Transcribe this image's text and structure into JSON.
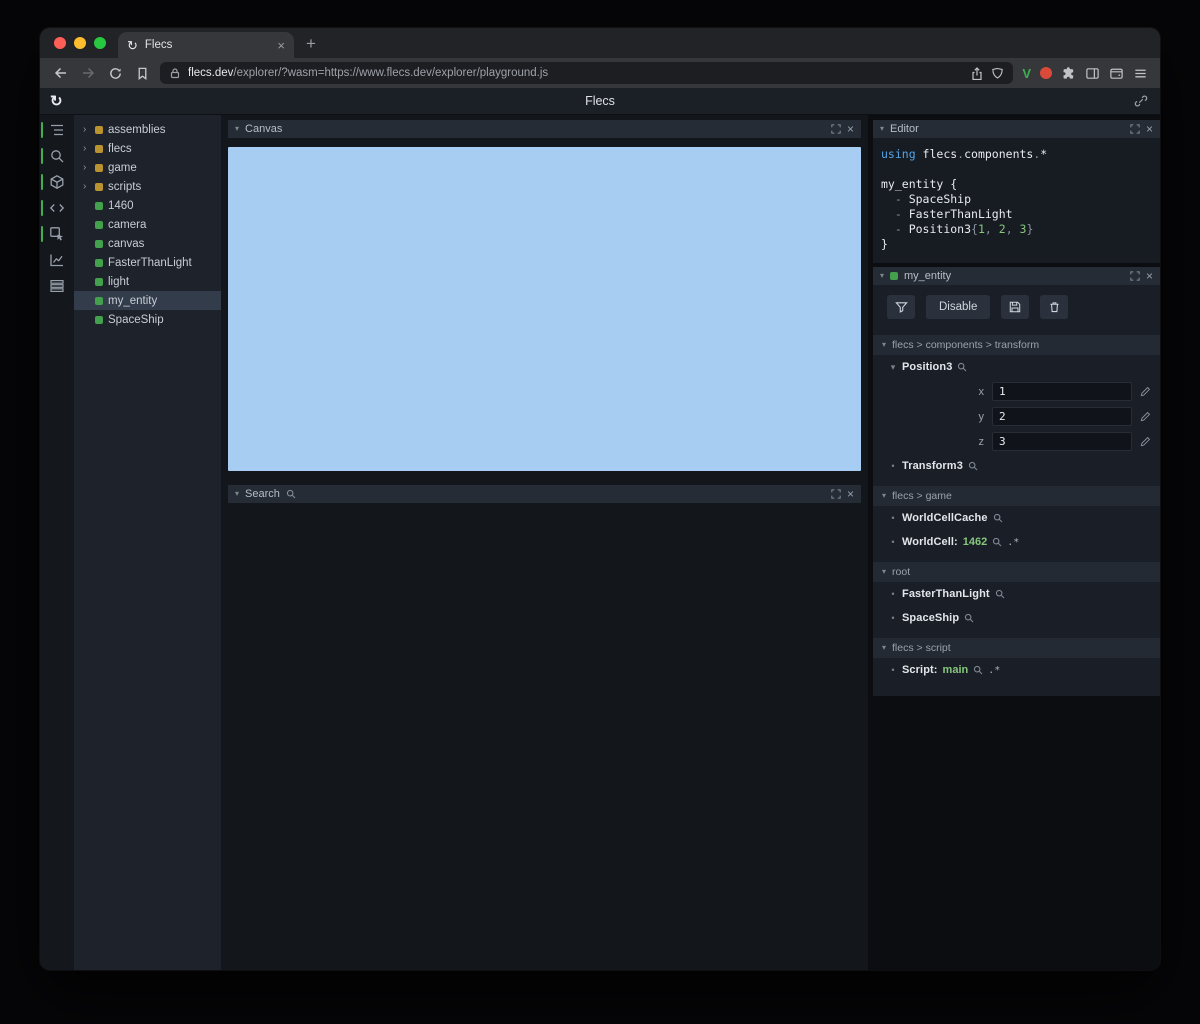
{
  "colors": {
    "canvas_blue": "#a7cdf2",
    "entity_green": "#43a04c",
    "module_orange": "#b9942e",
    "value_green": "#85c77c",
    "keyword_blue": "#55a4e8",
    "indicator_green": "#3fae4e"
  },
  "browser": {
    "tab_title": "Flecs",
    "url_host": "flecs.dev",
    "url_rest": "/explorer/?wasm=https://www.flecs.dev/explorer/playground.js"
  },
  "header": {
    "title": "Flecs"
  },
  "sidebar_icons": [
    {
      "name": "entity-tree",
      "active": true
    },
    {
      "name": "query-search",
      "active": true
    },
    {
      "name": "commands",
      "active": true
    },
    {
      "name": "code-editor",
      "active": true
    },
    {
      "name": "inspector",
      "active": true
    },
    {
      "name": "statistics",
      "active": false
    },
    {
      "name": "tables",
      "active": false
    }
  ],
  "tree": {
    "items": [
      {
        "label": "assemblies",
        "kind": "module"
      },
      {
        "label": "flecs",
        "kind": "module"
      },
      {
        "label": "game",
        "kind": "module"
      },
      {
        "label": "scripts",
        "kind": "module"
      },
      {
        "label": "1460",
        "kind": "entity"
      },
      {
        "label": "camera",
        "kind": "entity"
      },
      {
        "label": "canvas",
        "kind": "entity"
      },
      {
        "label": "FasterThanLight",
        "kind": "entity"
      },
      {
        "label": "light",
        "kind": "entity"
      },
      {
        "label": "my_entity",
        "kind": "entity",
        "selected": true
      },
      {
        "label": "SpaceShip",
        "kind": "entity"
      }
    ]
  },
  "canvas_panel": {
    "title": "Canvas"
  },
  "search_panel": {
    "title": "Search"
  },
  "editor_panel": {
    "title": "Editor",
    "lines": [
      [
        {
          "t": "using ",
          "c": "kw"
        },
        {
          "t": "flecs",
          "c": "id"
        },
        {
          "t": ".",
          "c": "dim"
        },
        {
          "t": "components",
          "c": "id"
        },
        {
          "t": ".",
          "c": "dim"
        },
        {
          "t": "*",
          "c": "id"
        }
      ],
      [],
      [
        {
          "t": "my_entity {",
          "c": "id"
        }
      ],
      [
        {
          "t": "  - ",
          "c": "dim"
        },
        {
          "t": "SpaceShip",
          "c": "id"
        }
      ],
      [
        {
          "t": "  - ",
          "c": "dim"
        },
        {
          "t": "FasterThanLight",
          "c": "id"
        }
      ],
      [
        {
          "t": "  - ",
          "c": "dim"
        },
        {
          "t": "Position3",
          "c": "id"
        },
        {
          "t": "{",
          "c": "dim"
        },
        {
          "t": "1",
          "c": "num"
        },
        {
          "t": ", ",
          "c": "dim"
        },
        {
          "t": "2",
          "c": "num"
        },
        {
          "t": ", ",
          "c": "dim"
        },
        {
          "t": "3",
          "c": "num"
        },
        {
          "t": "}",
          "c": "dim"
        }
      ],
      [
        {
          "t": "}",
          "c": "id"
        }
      ]
    ]
  },
  "inspector_panel": {
    "title": "my_entity",
    "disable_label": "Disable",
    "sections": [
      {
        "path": "flecs > components > transform",
        "components": [
          {
            "name": "Position3",
            "expanded": true,
            "fields": [
              {
                "key": "x",
                "value": "1"
              },
              {
                "key": "y",
                "value": "2"
              },
              {
                "key": "z",
                "value": "3"
              }
            ]
          },
          {
            "name": "Transform3"
          }
        ]
      },
      {
        "path": "flecs > game",
        "components": [
          {
            "name": "WorldCellCache"
          },
          {
            "name": "WorldCell",
            "value": "1462",
            "wildcard": true
          }
        ]
      },
      {
        "path": "root",
        "components": [
          {
            "name": "FasterThanLight"
          },
          {
            "name": "SpaceShip"
          }
        ]
      },
      {
        "path": "flecs > script",
        "components": [
          {
            "name": "Script",
            "value": "main",
            "wildcard": true
          }
        ]
      }
    ]
  }
}
